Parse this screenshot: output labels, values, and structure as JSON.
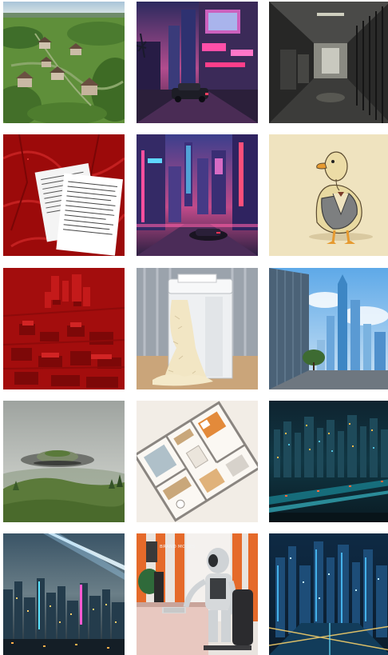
{
  "gallery": {
    "tiles": [
      {
        "id": "aerial-village",
        "icon": "village-image",
        "row": 1,
        "col": 1
      },
      {
        "id": "neon-street-car",
        "icon": "cyberpunk-street-image",
        "row": 1,
        "col": 2
      },
      {
        "id": "prison-corridor",
        "icon": "prison-corridor-image",
        "row": 1,
        "col": 3
      },
      {
        "id": "documents-red-map",
        "icon": "documents-image",
        "row": 2,
        "col": 1
      },
      {
        "id": "neon-city-night",
        "icon": "neon-city-image",
        "row": 2,
        "col": 2
      },
      {
        "id": "duck-jacket",
        "icon": "duck-illustration-image",
        "row": 2,
        "col": 3
      },
      {
        "id": "red-city-model",
        "icon": "red-city-image",
        "row": 3,
        "col": 1
      },
      {
        "id": "paper-shredder",
        "icon": "shredder-image",
        "row": 3,
        "col": 2
      },
      {
        "id": "glass-skyscrapers",
        "icon": "skyscrapers-image",
        "row": 3,
        "col": 3
      },
      {
        "id": "ufo-hill",
        "icon": "ufo-image",
        "row": 4,
        "col": 1
      },
      {
        "id": "apartment-floorplan",
        "icon": "floorplan-image",
        "row": 4,
        "col": 2
      },
      {
        "id": "city-lights-aerial",
        "icon": "city-lights-image",
        "row": 4,
        "col": 3
      },
      {
        "id": "city-light-beam",
        "icon": "city-beam-image",
        "row": 5,
        "col": 1
      },
      {
        "id": "robot-at-desk",
        "icon": "robot-office-image",
        "row": 5,
        "col": 2,
        "watermark": "BRAND MODES"
      },
      {
        "id": "blue-city-aerial",
        "icon": "blue-city-image",
        "row": 5,
        "col": 3
      }
    ]
  }
}
